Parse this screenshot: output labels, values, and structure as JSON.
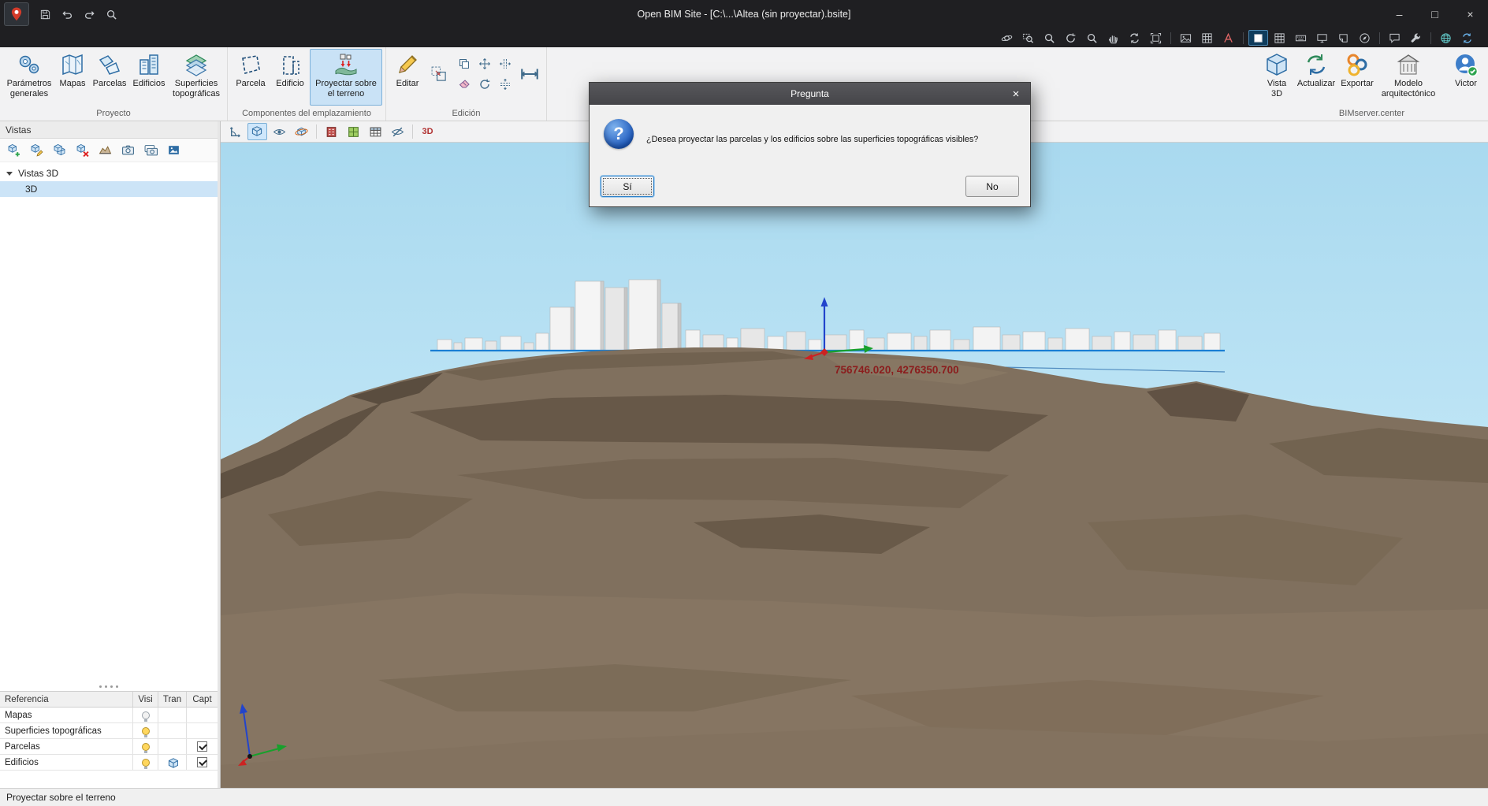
{
  "window": {
    "title": "Open BIM Site - [C:\\...\\Altea (sin proyectar).bsite]",
    "minimize_glyph": "–",
    "maximize_glyph": "□",
    "close_glyph": "×"
  },
  "quick_access": {
    "icons": [
      "save",
      "undo",
      "redo",
      "search"
    ]
  },
  "view_strip": {
    "icons": [
      "orbit-view",
      "zoom-window",
      "zoom-extents",
      "rotate-view",
      "zoom",
      "pan",
      "refresh",
      "frame-view",
      "texture",
      "terrain-grid",
      "annotations",
      "background",
      "grid",
      "keyboard",
      "windows",
      "clipping",
      "compass",
      "comments",
      "tools",
      "web",
      "sync"
    ]
  },
  "ribbon": {
    "groups": [
      {
        "label": "Proyecto",
        "buttons": [
          {
            "label": "Parámetros generales"
          },
          {
            "label": "Mapas"
          },
          {
            "label": "Parcelas"
          },
          {
            "label": "Edificios"
          },
          {
            "label": "Superficies topográficas"
          }
        ]
      },
      {
        "label": "Componentes del emplazamiento",
        "buttons": [
          {
            "label": "Parcela"
          },
          {
            "label": "Edificio"
          },
          {
            "label": "Proyectar sobre el terreno",
            "selected": true
          }
        ]
      },
      {
        "label": "Edición",
        "buttons": [
          {
            "label": "Editar"
          }
        ],
        "tools": [
          "offset",
          "copy",
          "move",
          "columns",
          "erase",
          "rotate",
          "rows",
          "measure"
        ]
      },
      {
        "label": "BIMserver.center",
        "buttons": [
          {
            "label": "Vista 3D"
          },
          {
            "label": "Actualizar"
          },
          {
            "label": "Exportar"
          },
          {
            "label": "Modelo arquitectónico"
          },
          {
            "label": "Victor"
          }
        ]
      }
    ]
  },
  "sidebar": {
    "title": "Vistas",
    "toolbar_icons": [
      "new-3d-view",
      "edit-view",
      "duplicate-view",
      "delete-view",
      "terrain-section",
      "snapshot",
      "snapshots",
      "gallery"
    ],
    "tree": {
      "root": "Vistas 3D",
      "child": "3D",
      "child_selected": true
    },
    "table": {
      "headers": [
        "Referencia",
        "Visi",
        "Tran",
        "Capt"
      ],
      "rows": [
        {
          "name": "Mapas",
          "visible": false,
          "transparent": false,
          "capturable": false,
          "has_capture_checkbox": false
        },
        {
          "name": "Superficies topográficas",
          "visible": true,
          "transparent": false,
          "capturable": false,
          "has_capture_checkbox": false
        },
        {
          "name": "Parcelas",
          "visible": true,
          "transparent": false,
          "capturable": true,
          "has_capture_checkbox": true
        },
        {
          "name": "Edificios",
          "visible": true,
          "transparent": true,
          "capturable": true,
          "has_capture_checkbox": true
        }
      ]
    }
  },
  "viewport": {
    "toolbar_icons": [
      "axes",
      "view-cube",
      "visibility",
      "orbit",
      "edificios-layer",
      "parcelas-layer",
      "tables",
      "hide-elements",
      "labels-3d"
    ],
    "view_cube_selected": true,
    "labels_3d": "3D",
    "coordinates": "756746.020, 4276350.700"
  },
  "dialog": {
    "title": "Pregunta",
    "icon_glyph": "?",
    "close_glyph": "×",
    "message": "¿Desea proyectar las parcelas y los edificios sobre las superficies topográficas visibles?",
    "yes_label": "Sí",
    "no_label": "No"
  },
  "statusbar": {
    "text": "Proyectar sobre el terreno"
  },
  "colors": {
    "selection_highlight": "#cce4f7",
    "ribbon_selected_bg": "#c9e2f6",
    "sky": "#b7e1f3",
    "terrain": "#7c6c59",
    "parcel_line": "#1b7fd4",
    "coordinate_text": "#8b1d1d",
    "axis_x": "#cc2222",
    "axis_y": "#18a02c",
    "axis_z": "#2244cc"
  }
}
